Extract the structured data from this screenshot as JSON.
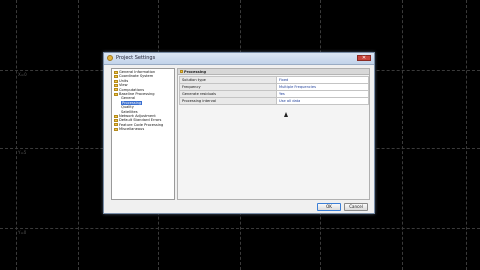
{
  "background": {
    "labels": [
      "X=0",
      "Y=5",
      "Y=0"
    ]
  },
  "dialog": {
    "title": "Project Settings",
    "close_glyph": "✕",
    "tree": [
      {
        "label": "General Information",
        "level": 0,
        "icon": "folder-icon"
      },
      {
        "label": "Coordinate System",
        "level": 0,
        "icon": "folder-icon"
      },
      {
        "label": "Units",
        "level": 0,
        "icon": "folder-icon"
      },
      {
        "label": "View",
        "level": 0,
        "icon": "folder-icon"
      },
      {
        "label": "Computations",
        "level": 0,
        "icon": "folder-icon"
      },
      {
        "label": "Baseline Processing",
        "level": 0,
        "icon": "folder-icon"
      },
      {
        "label": "General",
        "level": 1
      },
      {
        "label": "Processing",
        "level": 1,
        "selected": true
      },
      {
        "label": "Quality",
        "level": 1
      },
      {
        "label": "Satellites",
        "level": 1
      },
      {
        "label": "Network Adjustment",
        "level": 0,
        "icon": "folder-icon"
      },
      {
        "label": "Default Standard Errors",
        "level": 0,
        "icon": "folder-icon"
      },
      {
        "label": "Feature Code Processing",
        "level": 0,
        "icon": "folder-icon"
      },
      {
        "label": "Miscellaneous",
        "level": 0,
        "icon": "folder-icon"
      }
    ],
    "panel_title": "Processing",
    "properties": [
      {
        "name": "Solution type",
        "value": "Fixed"
      },
      {
        "name": "Frequency",
        "value": "Multiple Frequencies"
      },
      {
        "name": "Generate residuals",
        "value": "Yes"
      },
      {
        "name": "Processing interval",
        "value": "Use all data"
      }
    ],
    "buttons": {
      "ok": "OK",
      "cancel": "Cancel"
    }
  }
}
